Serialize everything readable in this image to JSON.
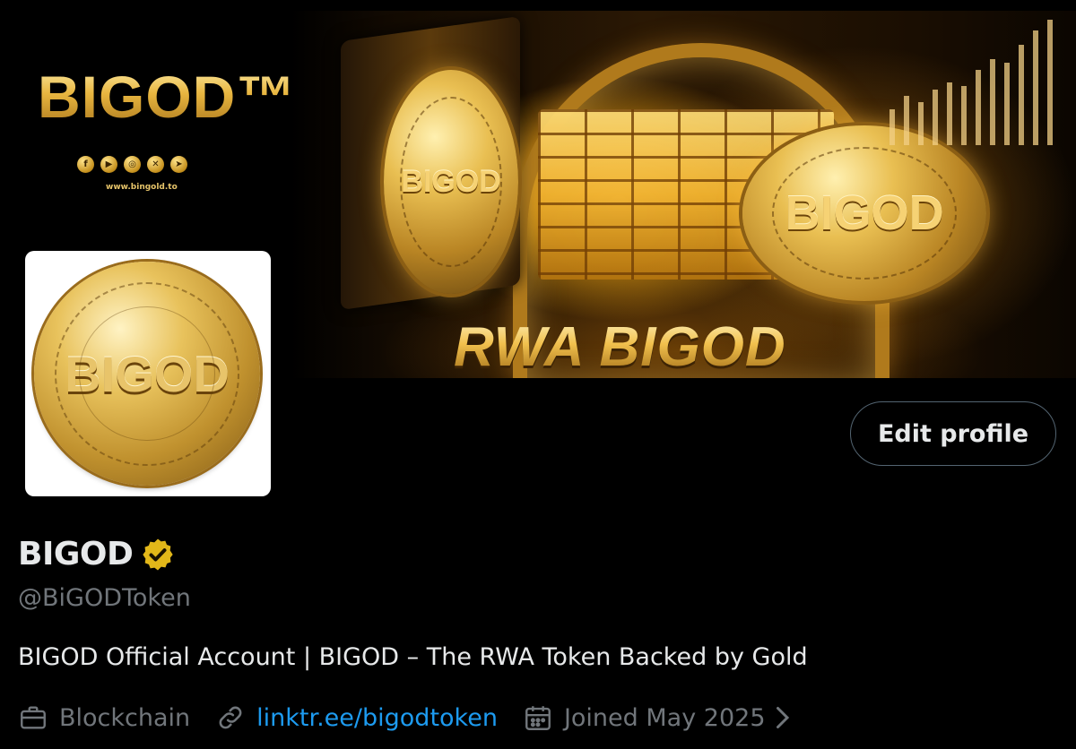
{
  "banner": {
    "brand_logo": "BIGOD™",
    "social_icons": [
      "facebook-icon",
      "youtube-icon",
      "instagram-icon",
      "x-icon",
      "telegram-icon"
    ],
    "website": "www.bingold.to",
    "coin_left_text": "BIGOD",
    "coin_right_text": "BIGOD",
    "headline": "RWA BIGOD"
  },
  "avatar": {
    "coin_text": "BIGOD"
  },
  "actions": {
    "edit_profile_label": "Edit profile"
  },
  "profile": {
    "display_name": "BIGOD",
    "verified_badge_color": "#e2b719",
    "handle": "@BiGODToken",
    "bio": "BIGOD Official Account | BIGOD – The RWA Token Backed by Gold",
    "category": "Blockchain",
    "link": "linktr.ee/bigodtoken",
    "joined": "Joined May 2025"
  },
  "colors": {
    "background": "#000000",
    "text_primary": "#e7e9ea",
    "text_secondary": "#71767b",
    "link": "#1d9bf0",
    "gold": "#e9bd4a"
  }
}
